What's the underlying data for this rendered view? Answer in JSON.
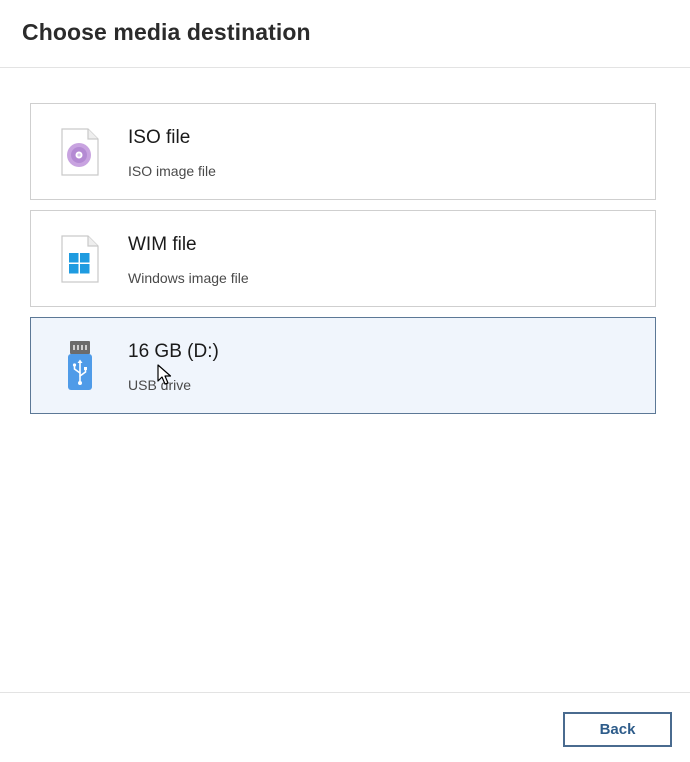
{
  "header": {
    "title": "Choose media destination"
  },
  "options": [
    {
      "title": "ISO file",
      "subtitle": "ISO image file",
      "icon": "disc-file-icon",
      "selected": false
    },
    {
      "title": "WIM file",
      "subtitle": "Windows image file",
      "icon": "windows-file-icon",
      "selected": false
    },
    {
      "title": "16 GB (D:)",
      "subtitle": "USB drive",
      "icon": "usb-drive-icon",
      "selected": true
    }
  ],
  "footer": {
    "back_label": "Back"
  },
  "colors": {
    "accent": "#2e5c8a",
    "selected_bg": "#f0f5fc",
    "selected_border": "#5c7896",
    "disc": "#b98fd6",
    "windows_logo": "#1e9be0",
    "usb": "#4f9be8"
  }
}
